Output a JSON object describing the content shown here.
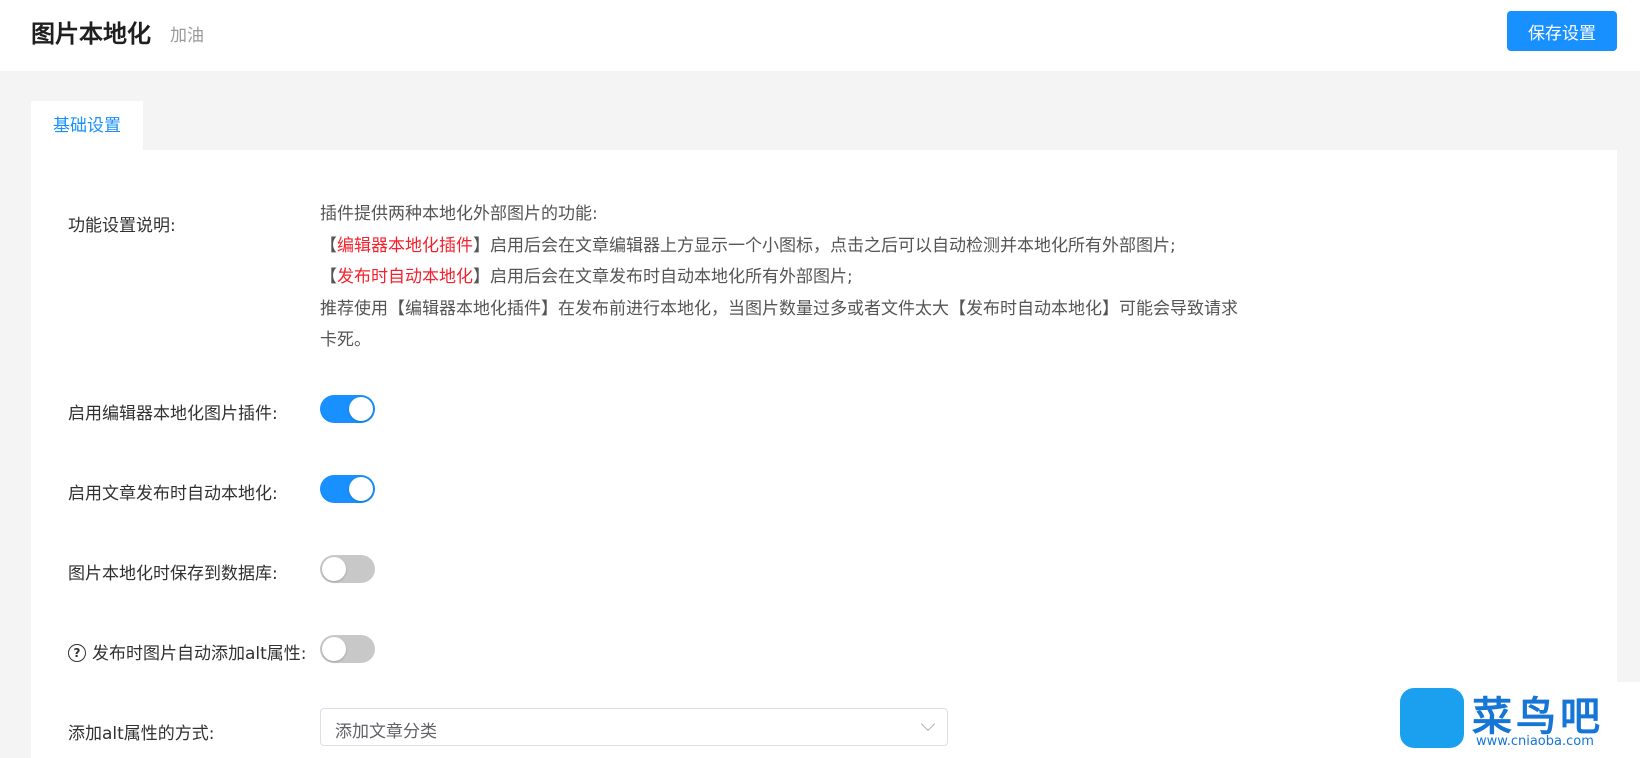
{
  "header": {
    "title": "图片本地化",
    "subtitle": "加油",
    "save_label": "保存设置"
  },
  "tabs": [
    {
      "label": "基础设置",
      "active": true
    }
  ],
  "description": {
    "label": "功能设置说明:",
    "line1": "插件提供两种本地化外部图片的功能:",
    "line2_pre": "【",
    "line2_red": "编辑器本地化插件",
    "line2_post": "】启用后会在文章编辑器上方显示一个小图标，点击之后可以自动检测并本地化所有外部图片;",
    "line3_pre": "【",
    "line3_red": "发布时自动本地化",
    "line3_post": "】启用后会在文章发布时自动本地化所有外部图片;",
    "line4": "推荐使用【编辑器本地化插件】在发布前进行本地化，当图片数量过多或者文件太大【发布时自动本地化】可能会导致请求卡死。"
  },
  "settings": [
    {
      "label": "启用编辑器本地化图片插件:",
      "enabled": true
    },
    {
      "label": "启用文章发布时自动本地化:",
      "enabled": true
    },
    {
      "label": "图片本地化时保存到数据库:",
      "enabled": false
    },
    {
      "label": "发布时图片自动添加alt属性:",
      "enabled": false,
      "help_icon": "question-circle-icon"
    }
  ],
  "alt_method": {
    "label": "添加alt属性的方式:",
    "value": "添加文章分类"
  },
  "watermark": {
    "text": "菜鸟吧",
    "url": "www.cniaoba.com"
  },
  "colors": {
    "accent": "#1890ff",
    "highlight": "#f5222d",
    "switch_off": "#c8c8c8",
    "background": "#f4f4f4"
  }
}
